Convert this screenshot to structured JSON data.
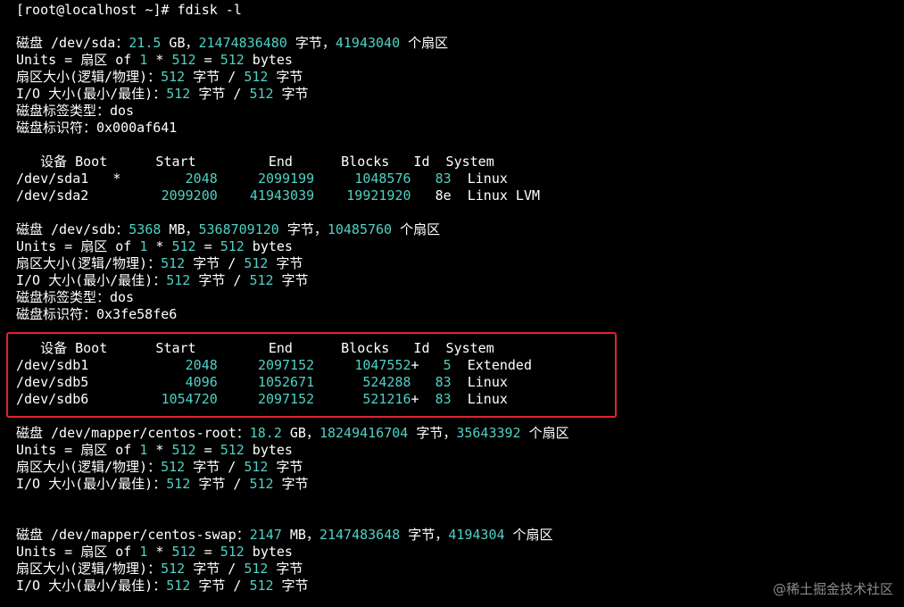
{
  "prompt": {
    "text": "[root@localhost ~]# fdisk -l"
  },
  "sections": [
    {
      "disk_line": [
        {
          "t": "磁盘 /dev/sda："
        },
        {
          "t": "21.5",
          "n": true
        },
        {
          "t": " GB，"
        },
        {
          "t": "21474836480",
          "n": true
        },
        {
          "t": " 字节，"
        },
        {
          "t": "41943040",
          "n": true
        },
        {
          "t": " 个扇区"
        }
      ],
      "info_lines": [
        [
          {
            "t": "Units = 扇区 of "
          },
          {
            "t": "1",
            "n": true
          },
          {
            "t": " * "
          },
          {
            "t": "512",
            "n": true
          },
          {
            "t": " = "
          },
          {
            "t": "512",
            "n": true
          },
          {
            "t": " bytes"
          }
        ],
        [
          {
            "t": "扇区大小(逻辑/物理)："
          },
          {
            "t": "512",
            "n": true
          },
          {
            "t": " 字节 / "
          },
          {
            "t": "512",
            "n": true
          },
          {
            "t": " 字节"
          }
        ],
        [
          {
            "t": "I/O 大小(最小/最佳)："
          },
          {
            "t": "512",
            "n": true
          },
          {
            "t": " 字节 / "
          },
          {
            "t": "512",
            "n": true
          },
          {
            "t": " 字节"
          }
        ],
        [
          {
            "t": "磁盘标签类型：dos"
          }
        ],
        [
          {
            "t": "磁盘标识符：0x000af641"
          }
        ]
      ],
      "table_header": "   设备 Boot      Start         End      Blocks   Id  System",
      "partitions": [
        [
          {
            "t": "/dev/sda1   *        "
          },
          {
            "t": "2048",
            "n": true
          },
          {
            "t": "     "
          },
          {
            "t": "2099199",
            "n": true
          },
          {
            "t": "     "
          },
          {
            "t": "1048576",
            "n": true
          },
          {
            "t": "   "
          },
          {
            "t": "83",
            "n": true
          },
          {
            "t": "  Linux"
          }
        ],
        [
          {
            "t": "/dev/sda2         "
          },
          {
            "t": "2099200",
            "n": true
          },
          {
            "t": "    "
          },
          {
            "t": "41943039",
            "n": true
          },
          {
            "t": "    "
          },
          {
            "t": "19921920",
            "n": true
          },
          {
            "t": "   8e  Linux LVM"
          }
        ]
      ]
    },
    {
      "disk_line": [
        {
          "t": "磁盘 /dev/sdb："
        },
        {
          "t": "5368",
          "n": true
        },
        {
          "t": " MB，"
        },
        {
          "t": "5368709120",
          "n": true
        },
        {
          "t": " 字节，"
        },
        {
          "t": "10485760",
          "n": true
        },
        {
          "t": " 个扇区"
        }
      ],
      "info_lines": [
        [
          {
            "t": "Units = 扇区 of "
          },
          {
            "t": "1",
            "n": true
          },
          {
            "t": " * "
          },
          {
            "t": "512",
            "n": true
          },
          {
            "t": " = "
          },
          {
            "t": "512",
            "n": true
          },
          {
            "t": " bytes"
          }
        ],
        [
          {
            "t": "扇区大小(逻辑/物理)："
          },
          {
            "t": "512",
            "n": true
          },
          {
            "t": " 字节 / "
          },
          {
            "t": "512",
            "n": true
          },
          {
            "t": " 字节"
          }
        ],
        [
          {
            "t": "I/O 大小(最小/最佳)："
          },
          {
            "t": "512",
            "n": true
          },
          {
            "t": " 字节 / "
          },
          {
            "t": "512",
            "n": true
          },
          {
            "t": " 字节"
          }
        ],
        [
          {
            "t": "磁盘标签类型：dos"
          }
        ],
        [
          {
            "t": "磁盘标识符：0x3fe58fe6"
          }
        ]
      ],
      "table_header": "   设备 Boot      Start         End      Blocks   Id  System",
      "partitions": [
        [
          {
            "t": "/dev/sdb1            "
          },
          {
            "t": "2048",
            "n": true
          },
          {
            "t": "     "
          },
          {
            "t": "2097152",
            "n": true
          },
          {
            "t": "     "
          },
          {
            "t": "1047552",
            "n": true
          },
          {
            "t": "+   "
          },
          {
            "t": "5",
            "n": true
          },
          {
            "t": "  Extended"
          }
        ],
        [
          {
            "t": "/dev/sdb5            "
          },
          {
            "t": "4096",
            "n": true
          },
          {
            "t": "     "
          },
          {
            "t": "1052671",
            "n": true
          },
          {
            "t": "      "
          },
          {
            "t": "524288",
            "n": true
          },
          {
            "t": "   "
          },
          {
            "t": "83",
            "n": true
          },
          {
            "t": "  Linux"
          }
        ],
        [
          {
            "t": "/dev/sdb6         "
          },
          {
            "t": "1054720",
            "n": true
          },
          {
            "t": "     "
          },
          {
            "t": "2097152",
            "n": true
          },
          {
            "t": "      "
          },
          {
            "t": "521216",
            "n": true
          },
          {
            "t": "+  "
          },
          {
            "t": "83",
            "n": true
          },
          {
            "t": "  Linux"
          }
        ]
      ]
    },
    {
      "disk_line": [
        {
          "t": "磁盘 /dev/mapper/centos-root："
        },
        {
          "t": "18.2",
          "n": true
        },
        {
          "t": " GB，"
        },
        {
          "t": "18249416704",
          "n": true
        },
        {
          "t": " 字节，"
        },
        {
          "t": "35643392",
          "n": true
        },
        {
          "t": " 个扇区"
        }
      ],
      "info_lines": [
        [
          {
            "t": "Units = 扇区 of "
          },
          {
            "t": "1",
            "n": true
          },
          {
            "t": " * "
          },
          {
            "t": "512",
            "n": true
          },
          {
            "t": " = "
          },
          {
            "t": "512",
            "n": true
          },
          {
            "t": " bytes"
          }
        ],
        [
          {
            "t": "扇区大小(逻辑/物理)："
          },
          {
            "t": "512",
            "n": true
          },
          {
            "t": " 字节 / "
          },
          {
            "t": "512",
            "n": true
          },
          {
            "t": " 字节"
          }
        ],
        [
          {
            "t": "I/O 大小(最小/最佳)："
          },
          {
            "t": "512",
            "n": true
          },
          {
            "t": " 字节 / "
          },
          {
            "t": "512",
            "n": true
          },
          {
            "t": " 字节"
          }
        ]
      ]
    },
    {
      "disk_line": [
        {
          "t": "磁盘 /dev/mapper/centos-swap："
        },
        {
          "t": "2147",
          "n": true
        },
        {
          "t": " MB，"
        },
        {
          "t": "2147483648",
          "n": true
        },
        {
          "t": " 字节，"
        },
        {
          "t": "4194304",
          "n": true
        },
        {
          "t": " 个扇区"
        }
      ],
      "info_lines": [
        [
          {
            "t": "Units = 扇区 of "
          },
          {
            "t": "1",
            "n": true
          },
          {
            "t": " * "
          },
          {
            "t": "512",
            "n": true
          },
          {
            "t": " = "
          },
          {
            "t": "512",
            "n": true
          },
          {
            "t": " bytes"
          }
        ],
        [
          {
            "t": "扇区大小(逻辑/物理)："
          },
          {
            "t": "512",
            "n": true
          },
          {
            "t": " 字节 / "
          },
          {
            "t": "512",
            "n": true
          },
          {
            "t": " 字节"
          }
        ],
        [
          {
            "t": "I/O 大小(最小/最佳)："
          },
          {
            "t": "512",
            "n": true
          },
          {
            "t": " 字节 / "
          },
          {
            "t": "512",
            "n": true
          },
          {
            "t": " 字节"
          }
        ]
      ]
    }
  ],
  "watermark": {
    "text": "@稀土掘金技术社区"
  },
  "colors": {
    "background": "#000000",
    "text": "#ffffff",
    "number": "#4fd1c5",
    "highlight_border": "#e1232c",
    "watermark": "#8a8a8a"
  }
}
